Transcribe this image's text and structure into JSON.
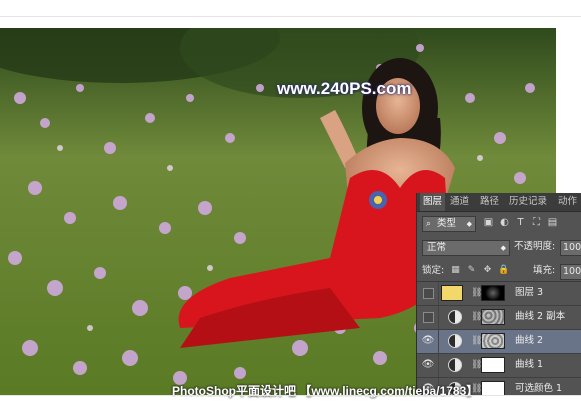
{
  "watermark": {
    "top_text": "www.240PS.com",
    "bottom_text": "PhotoShop平面设计吧 【www.linecg.com/tieba/1783】"
  },
  "image": {
    "subject": "woman in red dress sitting in a field of purple wildflowers",
    "colors": {
      "dress": "#d8151c",
      "foliage": "#6a8a2a",
      "flowers": "#c9a4d6",
      "hair": "#1d1512"
    }
  },
  "layers_panel": {
    "tabs": [
      {
        "label": "图层",
        "active": true
      },
      {
        "label": "通道",
        "active": false
      },
      {
        "label": "路径",
        "active": false
      },
      {
        "label": "历史记录",
        "active": false
      },
      {
        "label": "动作",
        "active": false
      }
    ],
    "filter_kind": {
      "label": "类型",
      "icon": "search-icon"
    },
    "filter_icons": [
      "pixel-filter-icon",
      "adjustment-filter-icon",
      "type-filter-icon",
      "shape-filter-icon",
      "smart-object-filter-icon"
    ],
    "blend_mode": "正常",
    "opacity_label": "不透明度:",
    "opacity_value": "100%",
    "lock_label": "锁定:",
    "lock_icons": [
      "lock-transparent-icon",
      "lock-image-icon",
      "lock-position-icon",
      "lock-all-icon"
    ],
    "fill_label": "填充:",
    "fill_value": "100%",
    "layers": [
      {
        "name": "图层 3",
        "visible": false,
        "selected": false,
        "type": "pixel",
        "thumb_color": "#f2d86a",
        "mask": "black"
      },
      {
        "name": "曲线 2 副本",
        "visible": false,
        "selected": false,
        "type": "adjustment",
        "mask": "cloud"
      },
      {
        "name": "曲线 2",
        "visible": true,
        "selected": true,
        "type": "adjustment",
        "mask": "cloud"
      },
      {
        "name": "曲线 1",
        "visible": true,
        "selected": false,
        "type": "adjustment",
        "mask": "white"
      },
      {
        "name": "可选颜色 1",
        "visible": true,
        "selected": false,
        "type": "adjustment",
        "mask": "white"
      }
    ],
    "accent_selected": "#6a7488"
  }
}
